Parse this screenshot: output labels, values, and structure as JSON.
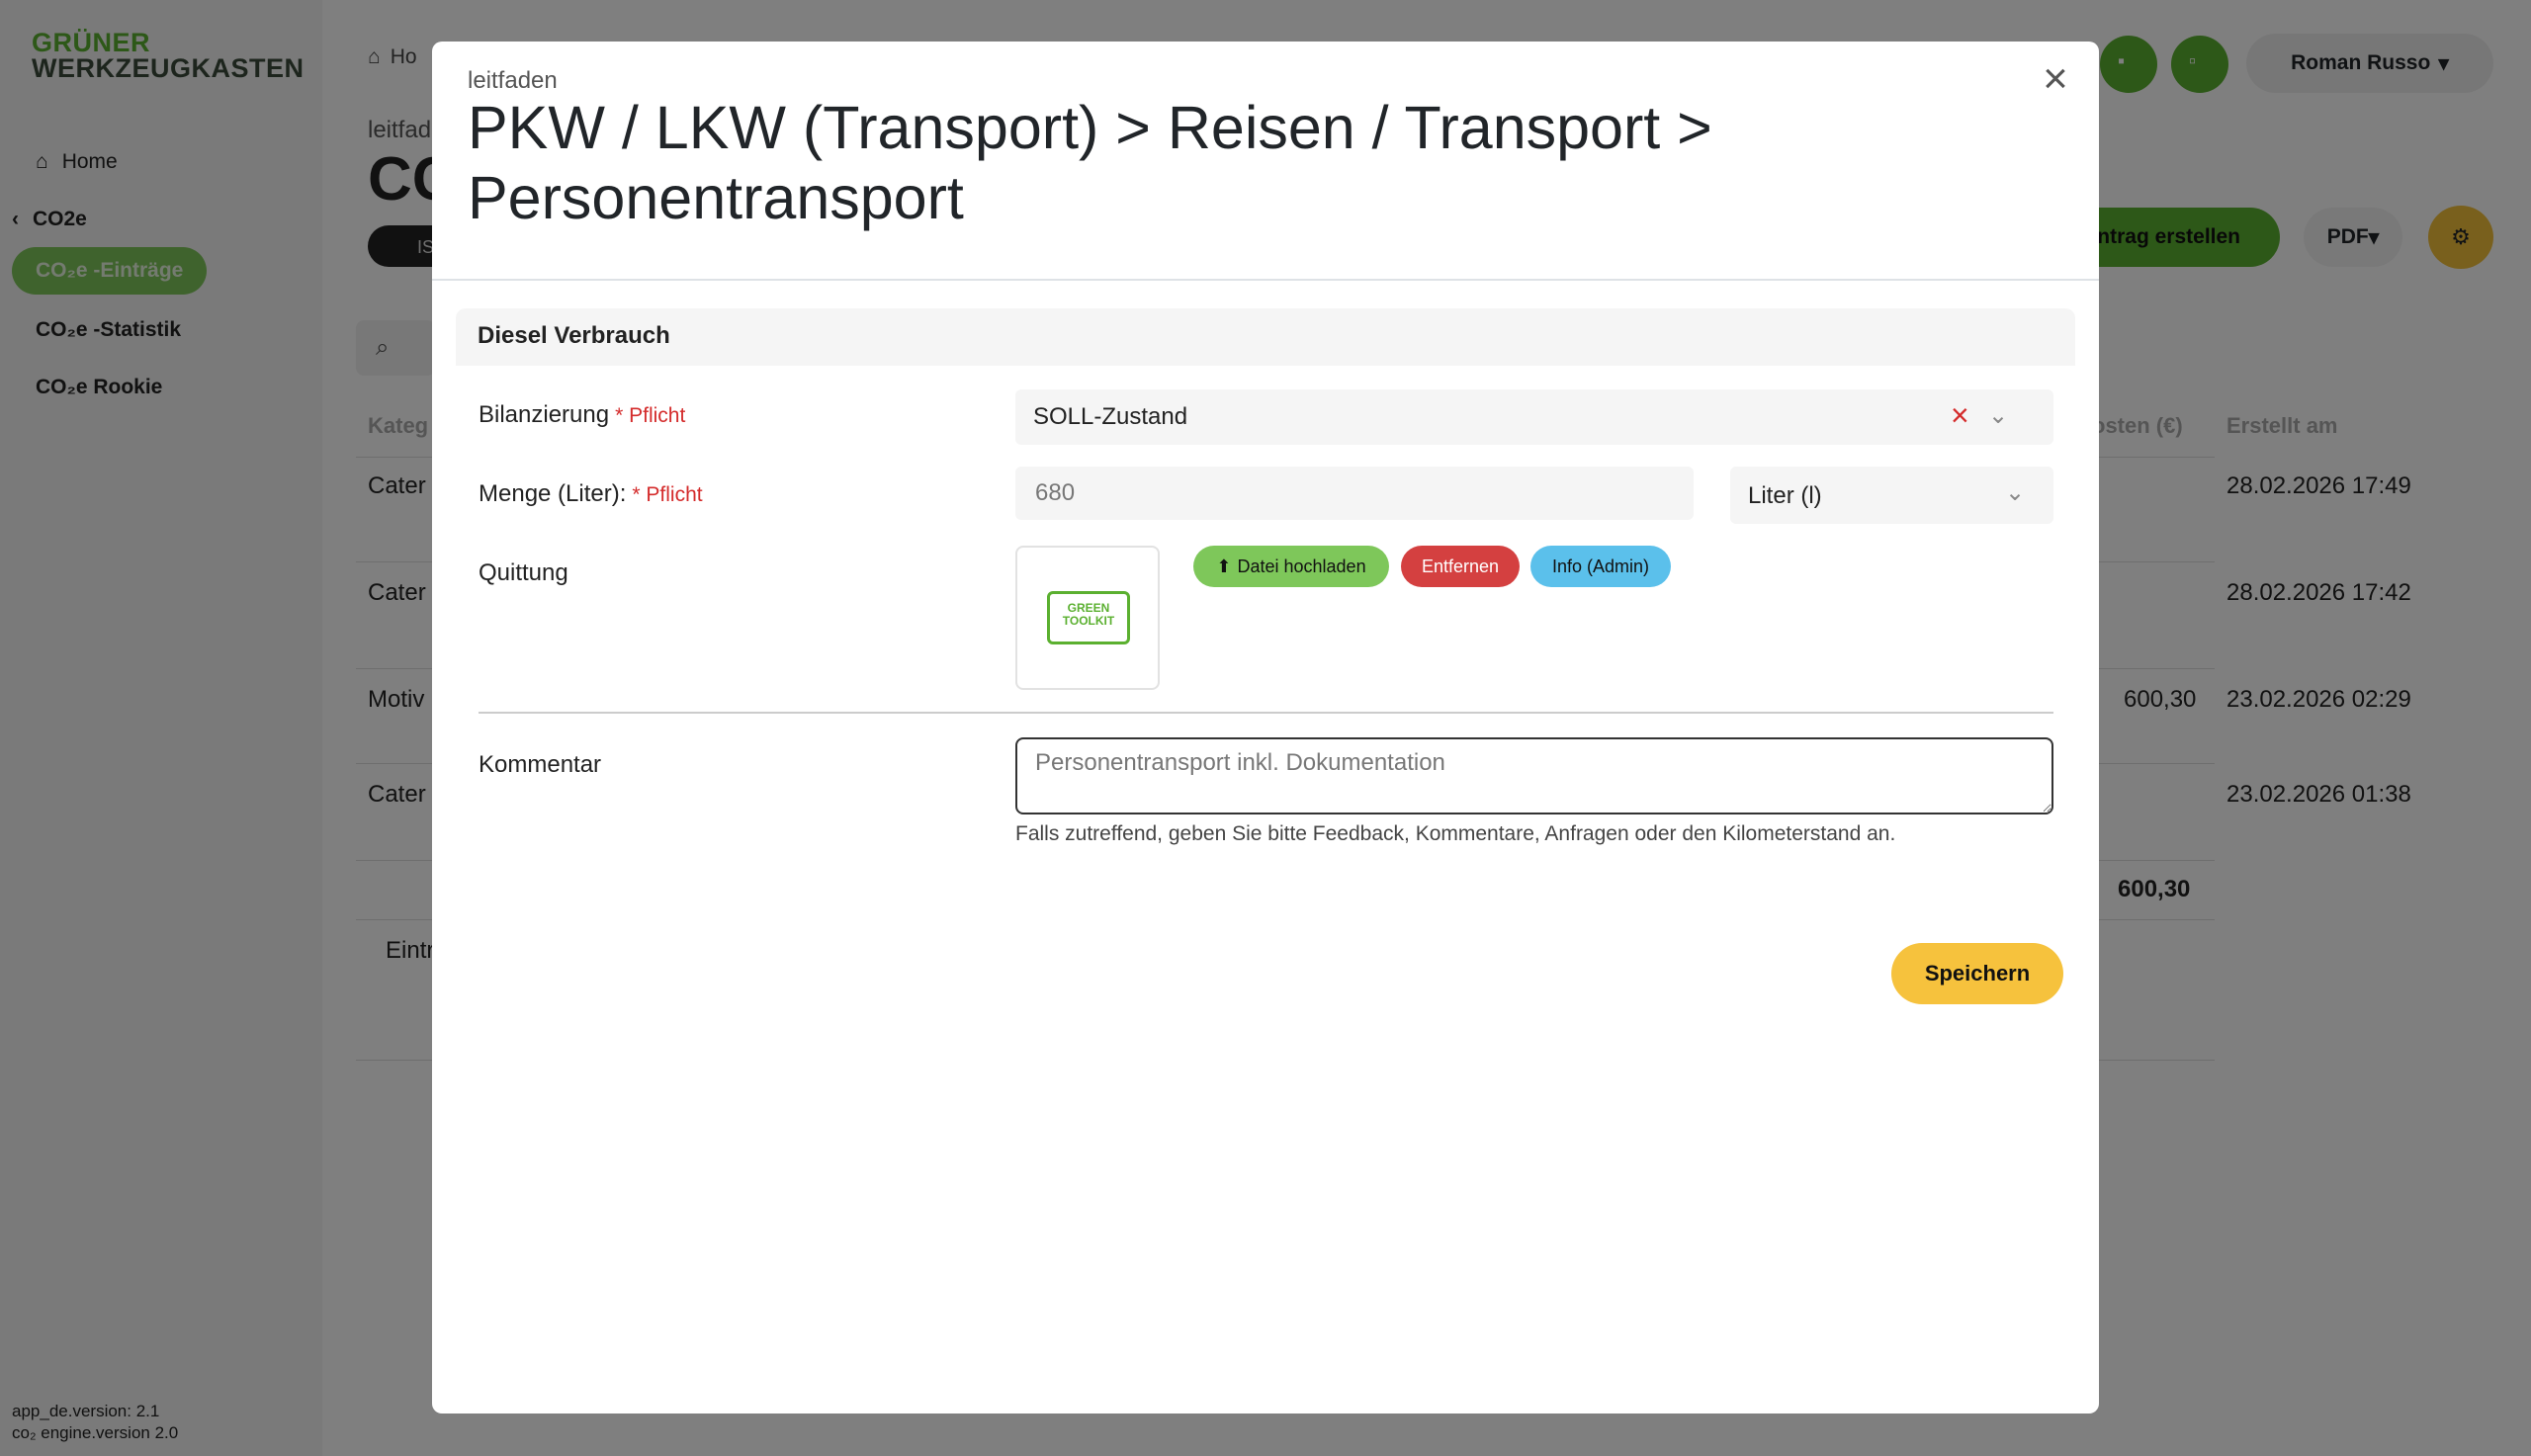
{
  "sidebar": {
    "logo_line1": "GRÜNER",
    "logo_line2": "WERKZEUGKASTEN",
    "home_label": "Home",
    "section_label": "CO2e",
    "items": [
      {
        "label": "CO₂e -Einträge",
        "active": true
      },
      {
        "label": "CO₂e -Statistik",
        "active": false
      },
      {
        "label": "CO₂e Rookie",
        "active": false
      }
    ],
    "version_app": "app_de.version: 2.1",
    "version_engine": "co₂ engine.version 2.0"
  },
  "background": {
    "breadcrumb_home": "Ho",
    "page_subtitle": "leitfad",
    "page_title": "CC",
    "dark_pill_label": "IS",
    "table_headers": {
      "col1": "Kateg",
      "costs": "osten (€)",
      "created": "Erstellt am"
    },
    "rows": [
      {
        "col1": "Cater",
        "costs": "",
        "created": "28.02.2026 17:49"
      },
      {
        "col1": "Cater",
        "costs": "",
        "created": "28.02.2026 17:42"
      },
      {
        "col1": "Motiv",
        "costs": "600,30",
        "created": "23.02.2026 02:29"
      },
      {
        "col1": "Cater",
        "costs": "",
        "created": "23.02.2026 01:38"
      }
    ],
    "total": "600,30",
    "footer_text": "Eintr",
    "user_name": "Roman Russo",
    "entry_button": "ntrag erstellen",
    "pdf_button": "PDF"
  },
  "modal": {
    "subtitle": "leitfaden",
    "title": "PKW / LKW (Transport) > Reisen / Transport > Personentransport",
    "section_title": "Diesel Verbrauch",
    "required_label": "* Pflicht",
    "fields": {
      "bilanzierung": {
        "label": "Bilanzierung",
        "value": "SOLL-Zustand"
      },
      "menge": {
        "label": "Menge (Liter):",
        "value": "680",
        "unit": "Liter (l)"
      },
      "quittung": {
        "label": "Quittung",
        "thumb_text": "GREEN TOOLKIT"
      },
      "kommentar": {
        "label": "Kommentar",
        "value": "Personentransport inkl. Dokumentation",
        "help": "Falls zutreffend, geben Sie bitte Feedback, Kommentare, Anfragen oder den Kilometerstand an."
      }
    },
    "buttons": {
      "upload": "Datei hochladen",
      "remove": "Entfernen",
      "info": "Info (Admin)",
      "save": "Speichern"
    }
  },
  "colors": {
    "brand_green": "#5bb030",
    "accent_yellow": "#f6c23d",
    "danger_red": "#d44040",
    "info_blue": "#5bc0eb"
  }
}
